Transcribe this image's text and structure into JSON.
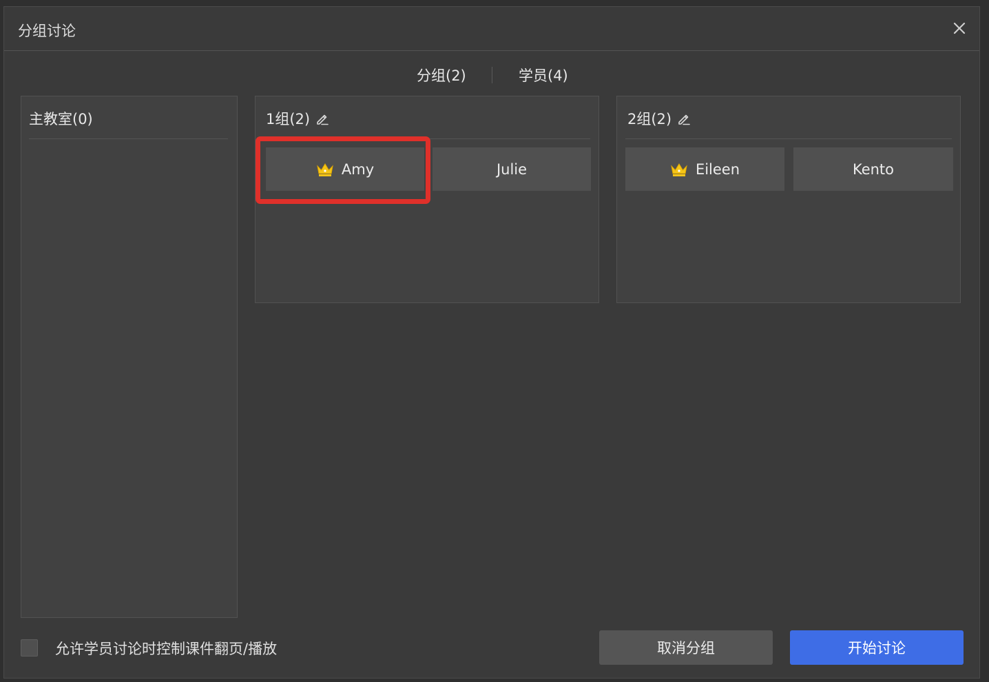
{
  "dialog": {
    "title": "分组讨论",
    "close_icon": "close-icon"
  },
  "tabs": [
    {
      "label": "分组(2)",
      "active": true
    },
    {
      "label": "学员(4)",
      "active": false
    }
  ],
  "main_room": {
    "title": "主教室(0)"
  },
  "groups": [
    {
      "title": "1组(2)",
      "edit_icon": "pencil-icon",
      "members": [
        {
          "name": "Amy",
          "leader": true,
          "leader_icon": "crown-icon"
        },
        {
          "name": "Julie",
          "leader": false
        }
      ]
    },
    {
      "title": "2组(2)",
      "edit_icon": "pencil-icon",
      "members": [
        {
          "name": "Eileen",
          "leader": true,
          "leader_icon": "crown-icon"
        },
        {
          "name": "Kento",
          "leader": false
        }
      ]
    }
  ],
  "footer": {
    "allow_control_label": "允许学员讨论时控制课件翻页/播放",
    "allow_control_checked": false,
    "cancel_button": "取消分组",
    "start_button": "开始讨论"
  },
  "colors": {
    "background": "#3a3a3a",
    "panel": "#414141",
    "member_card": "#505050",
    "primary_button": "#3e6de6",
    "secondary_button": "#555555",
    "highlight": "#e0302a",
    "crown": "#f5c518"
  }
}
